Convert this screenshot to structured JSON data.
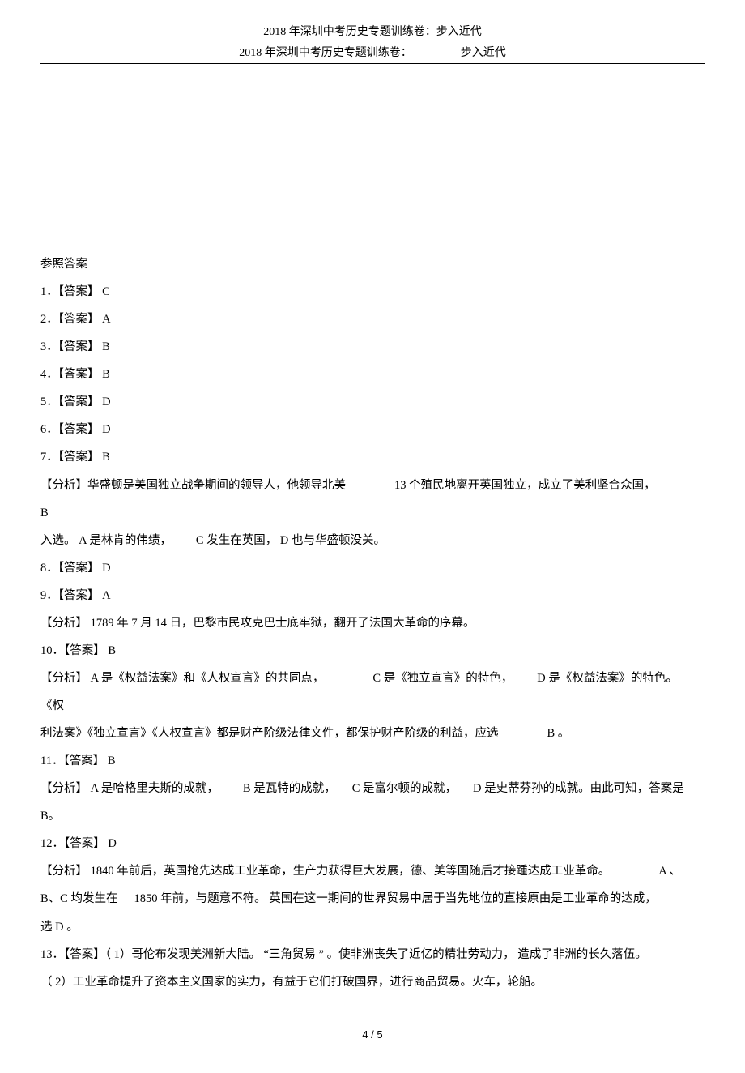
{
  "header": "2018 年深圳中考历史专题训练卷：步入近代",
  "subheader_left": "2018 年深圳中考历史专题训练卷：",
  "subheader_right": "步入近代",
  "section_title": "参照答案",
  "answers": {
    "a1": "1．【答案】 C",
    "a2": "2．【答案】 A",
    "a3": "3．【答案】 B",
    "a4": "4．【答案】 B",
    "a5": "5．【答案】 D",
    "a6": "6．【答案】 D",
    "a7": "7．【答案】 B",
    "a7_exp_p1a": "【分析】华盛顿是美国独立战争期间的领导人，他领导北美",
    "a7_exp_p1b": "13 个殖民地离开英国独立，成立了美利坚合众国，",
    "a7_exp_p1c": "B",
    "a7_exp_p2a": "入选。 A 是林肯的伟绩，",
    "a7_exp_p2b": "C 发生在英国， D 也与华盛顿没关。",
    "a8": "8．【答案】 D",
    "a9": "9．【答案】 A",
    "a9_exp": "【分析】 1789 年 7 月 14 日，巴黎市民攻克巴士底牢狱，翻开了法国大革命的序幕。",
    "a10": "10．【答案】 B",
    "a10_exp_p1a": "【分析】 A 是《权益法案》和《人权宣言》的共同点，",
    "a10_exp_p1b": "C 是《独立宣言》的特色，",
    "a10_exp_p1c": "D 是《权益法案》的特色。",
    "a10_exp_p1d": "《权",
    "a10_exp_p2a": "利法案》《独立宣言》《人权宣言》都是财产阶级法律文件，都保护财产阶级的利益，应选",
    "a10_exp_p2b": "B 。",
    "a11": "11．【答案】 B",
    "a11_exp_p1a": "【分析】 A 是哈格里夫斯的成就，",
    "a11_exp_p1b": "B 是瓦特的成就，",
    "a11_exp_p1c": "C 是富尔顿的成就，",
    "a11_exp_p1d": "D 是史蒂芬孙的成就。由此可知，答案是",
    "a11_exp_p2": "B。",
    "a12": "12．【答案】 D",
    "a12_exp_p1a": "【分析】 1840 年前后，英国抢先达成工业革命，生产力获得巨大发展，德、美等国随后才接踵达成工业革命。",
    "a12_exp_p1b": "A 、",
    "a12_exp_p2a": "B、C 均发生在",
    "a12_exp_p2b": "1850 年前，与题意不符。 英国在这一期间的世界贸易中居于当先地位的直接原由是工业革命的达成，",
    "a12_exp_p3": "选 D 。",
    "a13_p1": "13．【答案】（ 1）哥伦布发现美洲新大陆。 “三角贸易 ” 。使非洲丧失了近亿的精壮劳动力， 造成了非洲的长久落伍。",
    "a13_p2": "（ 2）工业革命提升了资本主义国家的实力，有益于它们打破国界，进行商品贸易。火车，轮船。"
  },
  "page_number": "4 / 5"
}
